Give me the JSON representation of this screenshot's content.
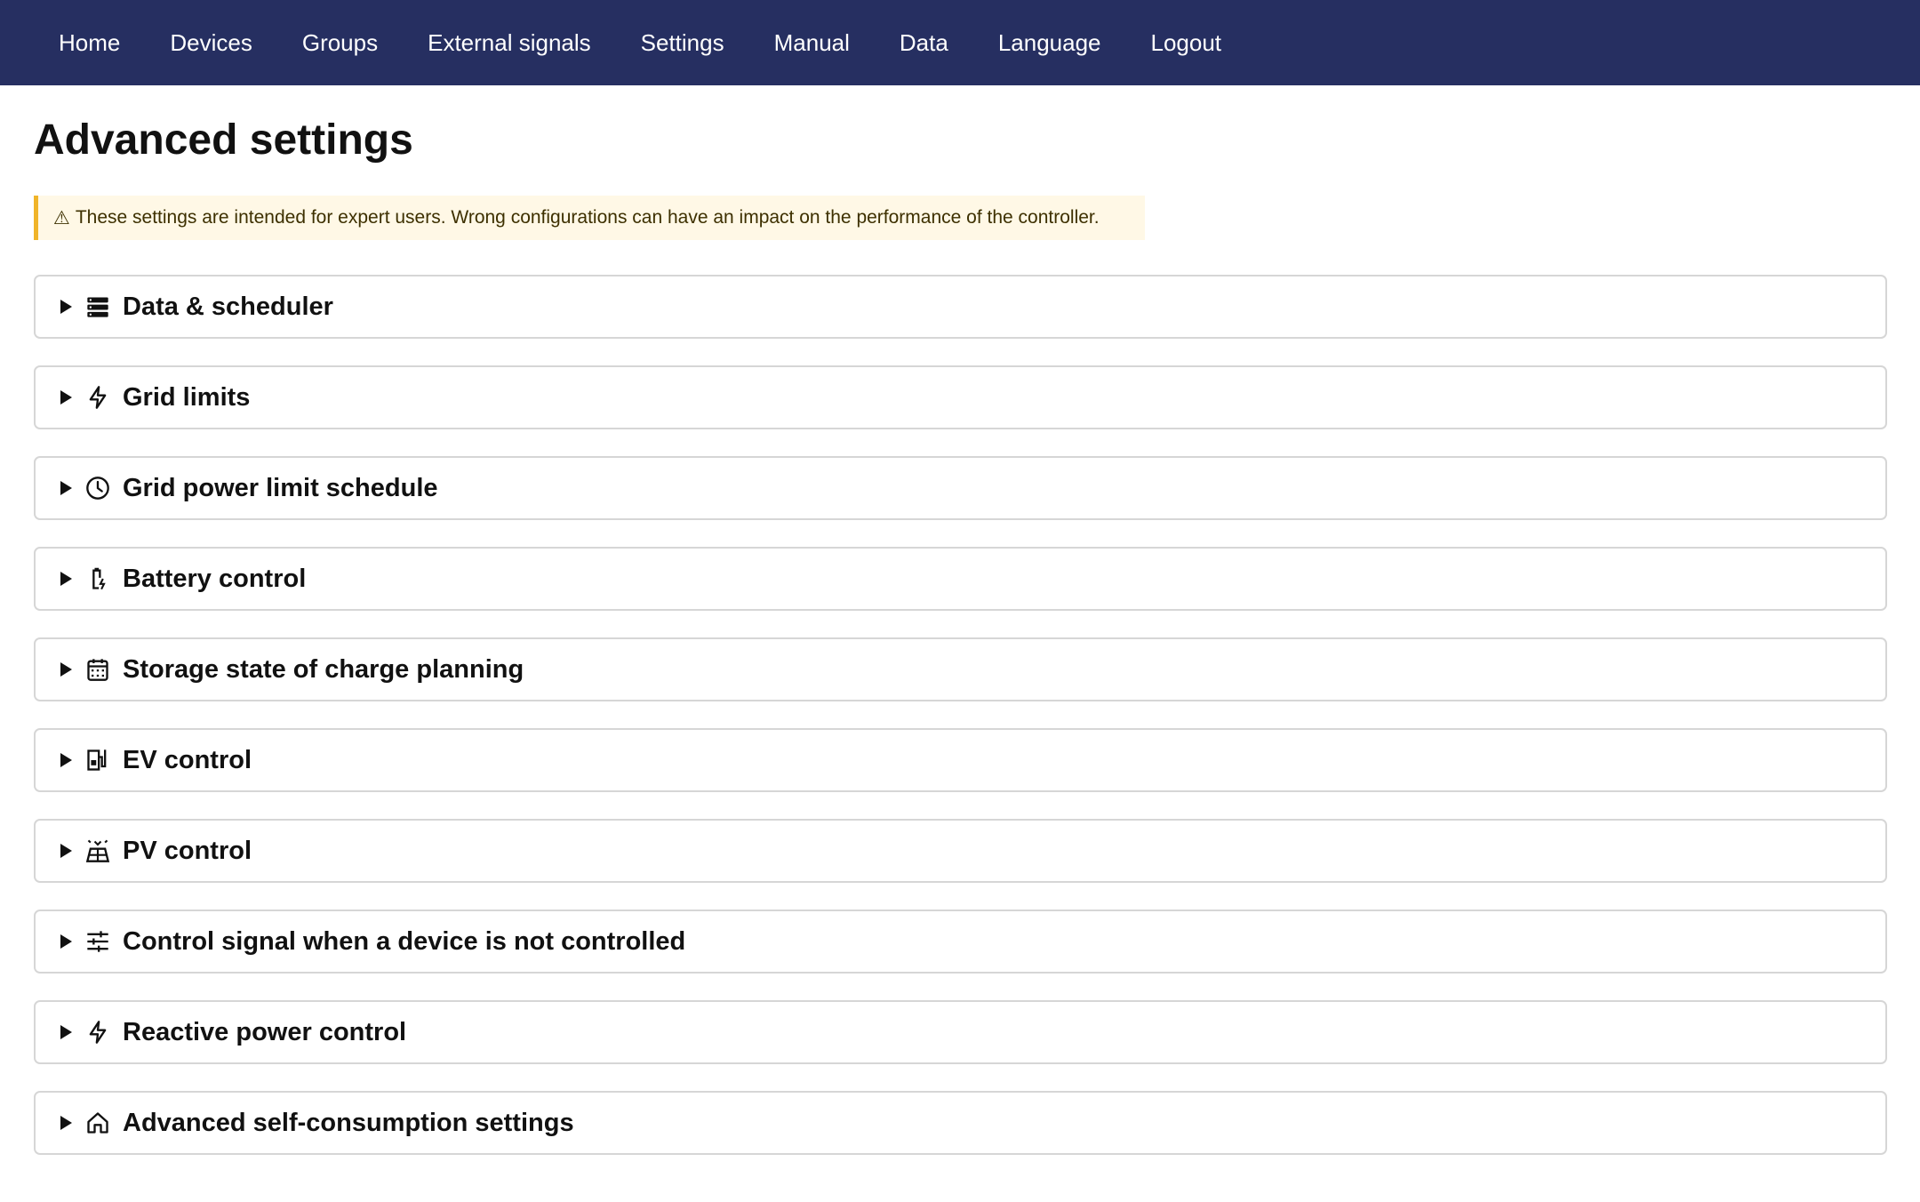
{
  "nav": {
    "items": [
      "Home",
      "Devices",
      "Groups",
      "External signals",
      "Settings",
      "Manual",
      "Data",
      "Language",
      "Logout"
    ]
  },
  "page": {
    "title": "Advanced settings",
    "warning_icon": "⚠",
    "warning": "These settings are intended for expert users. Wrong configurations can have an impact on the performance of the controller."
  },
  "sections": [
    {
      "label": "Data & scheduler",
      "icon": "server-icon"
    },
    {
      "label": "Grid limits",
      "icon": "bolt-icon"
    },
    {
      "label": "Grid power limit schedule",
      "icon": "clock-icon"
    },
    {
      "label": "Battery control",
      "icon": "battery-charging-icon"
    },
    {
      "label": "Storage state of charge planning",
      "icon": "calendar-icon"
    },
    {
      "label": "EV control",
      "icon": "ev-station-icon"
    },
    {
      "label": "PV control",
      "icon": "solar-panel-icon"
    },
    {
      "label": "Control signal when a device is not controlled",
      "icon": "sliders-icon"
    },
    {
      "label": "Reactive power control",
      "icon": "bolt-icon"
    },
    {
      "label": "Advanced self-consumption settings",
      "icon": "home-icon"
    }
  ],
  "colors": {
    "navbar_bg": "#262f61",
    "warning_bg": "#fff8e6",
    "warning_border": "#f0b429"
  }
}
